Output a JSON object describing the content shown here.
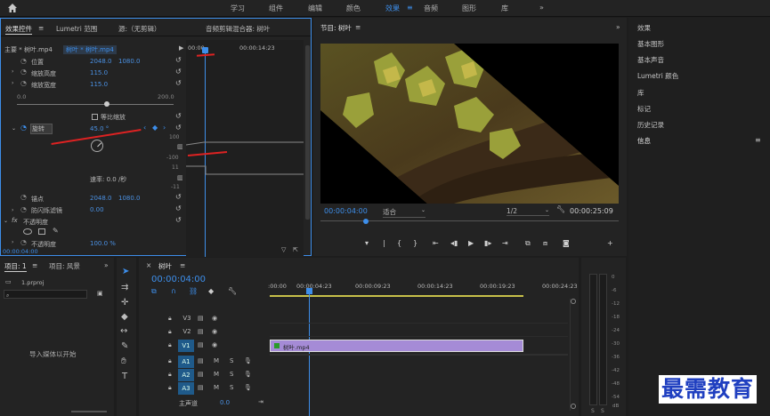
{
  "topbar": {
    "tabs": [
      "学习",
      "组件",
      "编辑",
      "颜色",
      "效果",
      "音频",
      "图形",
      "库"
    ],
    "active": "效果"
  },
  "effect_controls": {
    "tabs": [
      "效果控件",
      "Lumetri 范围",
      "源:（无剪辑）",
      "音频剪辑混合器: 树叶"
    ],
    "master": "主要 * 树叶.mp4",
    "clip": "树叶 * 树叶.mp4",
    "ruler": {
      "start": "00:00",
      "end": "00:00:14:23"
    },
    "props": [
      {
        "name": "位置",
        "v1": "2048.0",
        "v2": "1080.0"
      },
      {
        "name": "缩放高度",
        "v1": "115.0"
      },
      {
        "name": "缩放宽度",
        "v1": "115.0"
      }
    ],
    "slider": {
      "min": "0.0",
      "max": "200.0"
    },
    "uniform": "等比缩放",
    "rotation": {
      "name": "旋转",
      "value": "45.0 °"
    },
    "graph": {
      "top": "100",
      "bottom": "-100",
      "top2": "11",
      "bottom2": "-11"
    },
    "speed_label": "速率: 0.0 /秒",
    "anchor": {
      "name": "锚点",
      "v1": "2048.0",
      "v2": "1080.0"
    },
    "flicker": {
      "name": "防闪烁滤镜",
      "v": "0.00"
    },
    "opacity_section": "不透明度",
    "opacity": {
      "name": "不透明度",
      "v": "100.0 %"
    },
    "timecode": "00:00:04:00"
  },
  "program": {
    "title": "节目: 树叶",
    "timecode": "00:00:04:00",
    "fit": "适合",
    "quality": "1/2",
    "duration": "00:00:25:09"
  },
  "right_panel": {
    "items": [
      "效果",
      "基本图形",
      "基本声音",
      "Lumetri 颜色",
      "库",
      "标记",
      "历史记录",
      "信息"
    ]
  },
  "project": {
    "tabs": [
      "项目: 1",
      "项目: 风景"
    ],
    "file": "1.prproj",
    "placeholder": "导入媒体以开始"
  },
  "timeline": {
    "title": "树叶",
    "timecode": "00:00:04:00",
    "ruler": [
      ":00:00",
      "00:00:04:23",
      "00:00:09:23",
      "00:00:14:23",
      "00:00:19:23",
      "00:00:24:23"
    ],
    "video_tracks": [
      "V3",
      "V2",
      "V1"
    ],
    "audio_tracks": [
      "A1",
      "A2",
      "A3"
    ],
    "clip": "树叶.mp4",
    "master": {
      "label": "主声道",
      "value": "0.0"
    }
  },
  "meter": {
    "scale": [
      "0",
      "-6",
      "-12",
      "-18",
      "-24",
      "-30",
      "-36",
      "-42",
      "-48",
      "-54"
    ],
    "unit": "dB",
    "s": "S"
  },
  "watermark": "最需教育"
}
